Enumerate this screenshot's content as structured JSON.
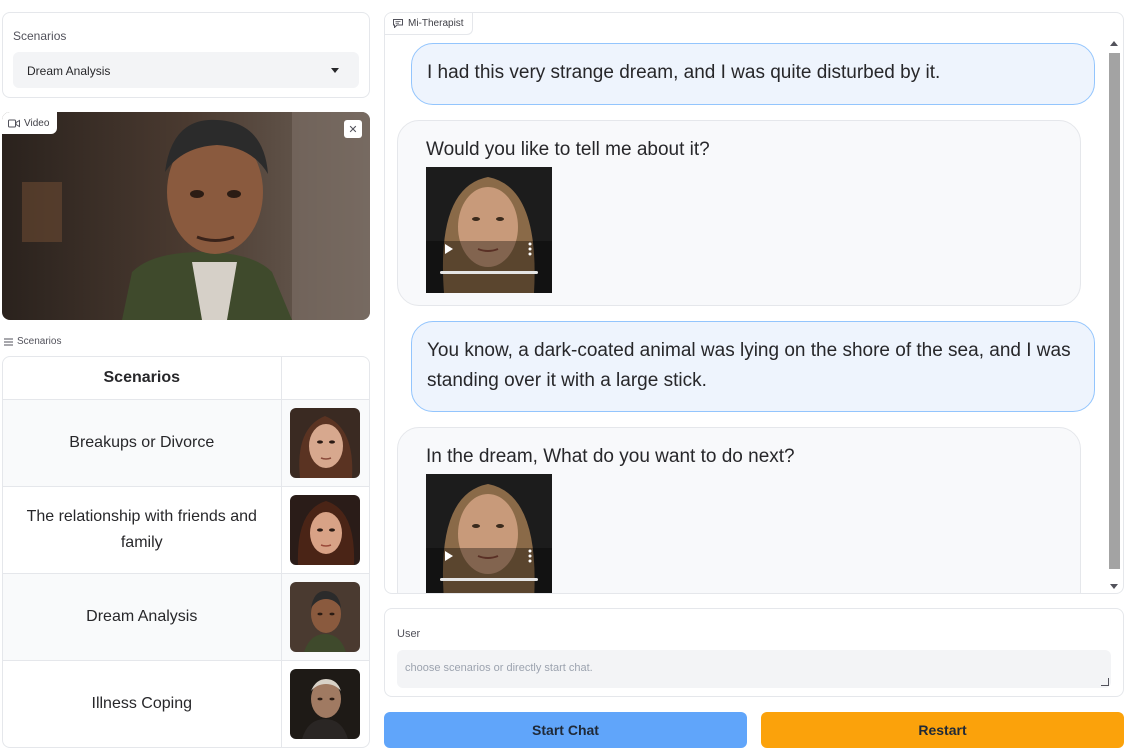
{
  "left": {
    "dropdown": {
      "label": "Scenarios",
      "value": "Dream Analysis"
    },
    "video": {
      "label": "Video"
    },
    "scenarios_label": "Scenarios",
    "table": {
      "header": "Scenarios",
      "rows": [
        {
          "label": "Breakups or Divorce"
        },
        {
          "label": "The relationship with friends and family"
        },
        {
          "label": "Dream Analysis"
        },
        {
          "label": "Illness Coping"
        }
      ]
    }
  },
  "chat": {
    "label": "Mi-Therapist",
    "messages": [
      {
        "role": "user",
        "text": "I had this very strange dream, and I was quite disturbed by it."
      },
      {
        "role": "bot",
        "text": "Would you like to tell me about it?"
      },
      {
        "role": "user",
        "text": "You know, a dark-coated animal was lying on the shore of the sea, and I was standing over it with a large stick."
      },
      {
        "role": "bot",
        "text": "In the dream, What do you want to do next?"
      }
    ]
  },
  "input": {
    "label": "User",
    "placeholder": "choose scenarios or directly start chat."
  },
  "buttons": {
    "start": "Start Chat",
    "restart": "Restart"
  },
  "colors": {
    "start_button": "#60a5fa",
    "restart_button": "#fba20b",
    "user_bubble": "#eef4fd",
    "user_bubble_border": "#93c5fd"
  }
}
